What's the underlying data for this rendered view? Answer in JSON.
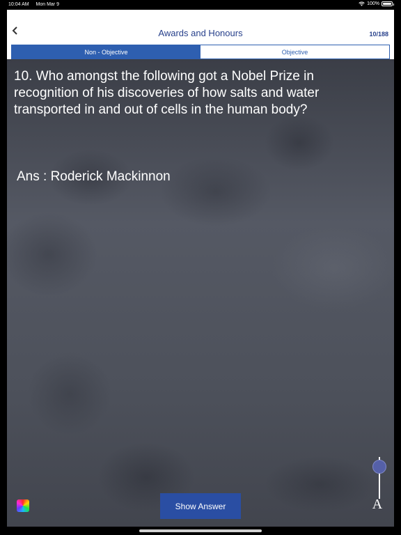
{
  "status_bar": {
    "time": "10:04 AM",
    "date": "Mon Mar 9",
    "battery": "100%"
  },
  "nav": {
    "back_icon": "chevron-left-icon",
    "title": "Awards and Honours",
    "counter": "10/188"
  },
  "tabs": [
    {
      "label": "Non - Objective",
      "active": true
    },
    {
      "label": "Objective",
      "active": false
    }
  ],
  "question": {
    "text": "10. Who amongst the following got a Nobel Prize in recognition of his discoveries of how salts and water transported in and out of cells in the human body?"
  },
  "answer": {
    "text": "Ans : Roderick Mackinnon"
  },
  "controls": {
    "show_answer_label": "Show Answer",
    "font_icon_glyph": "A",
    "color_icon": "color-palette-icon",
    "font_size_slider_value": 0.1
  },
  "colors": {
    "accent": "#27408b",
    "segment_active": "#2e5fb0",
    "button": "#2a4ea3",
    "slider_knob": "#5560a8"
  }
}
